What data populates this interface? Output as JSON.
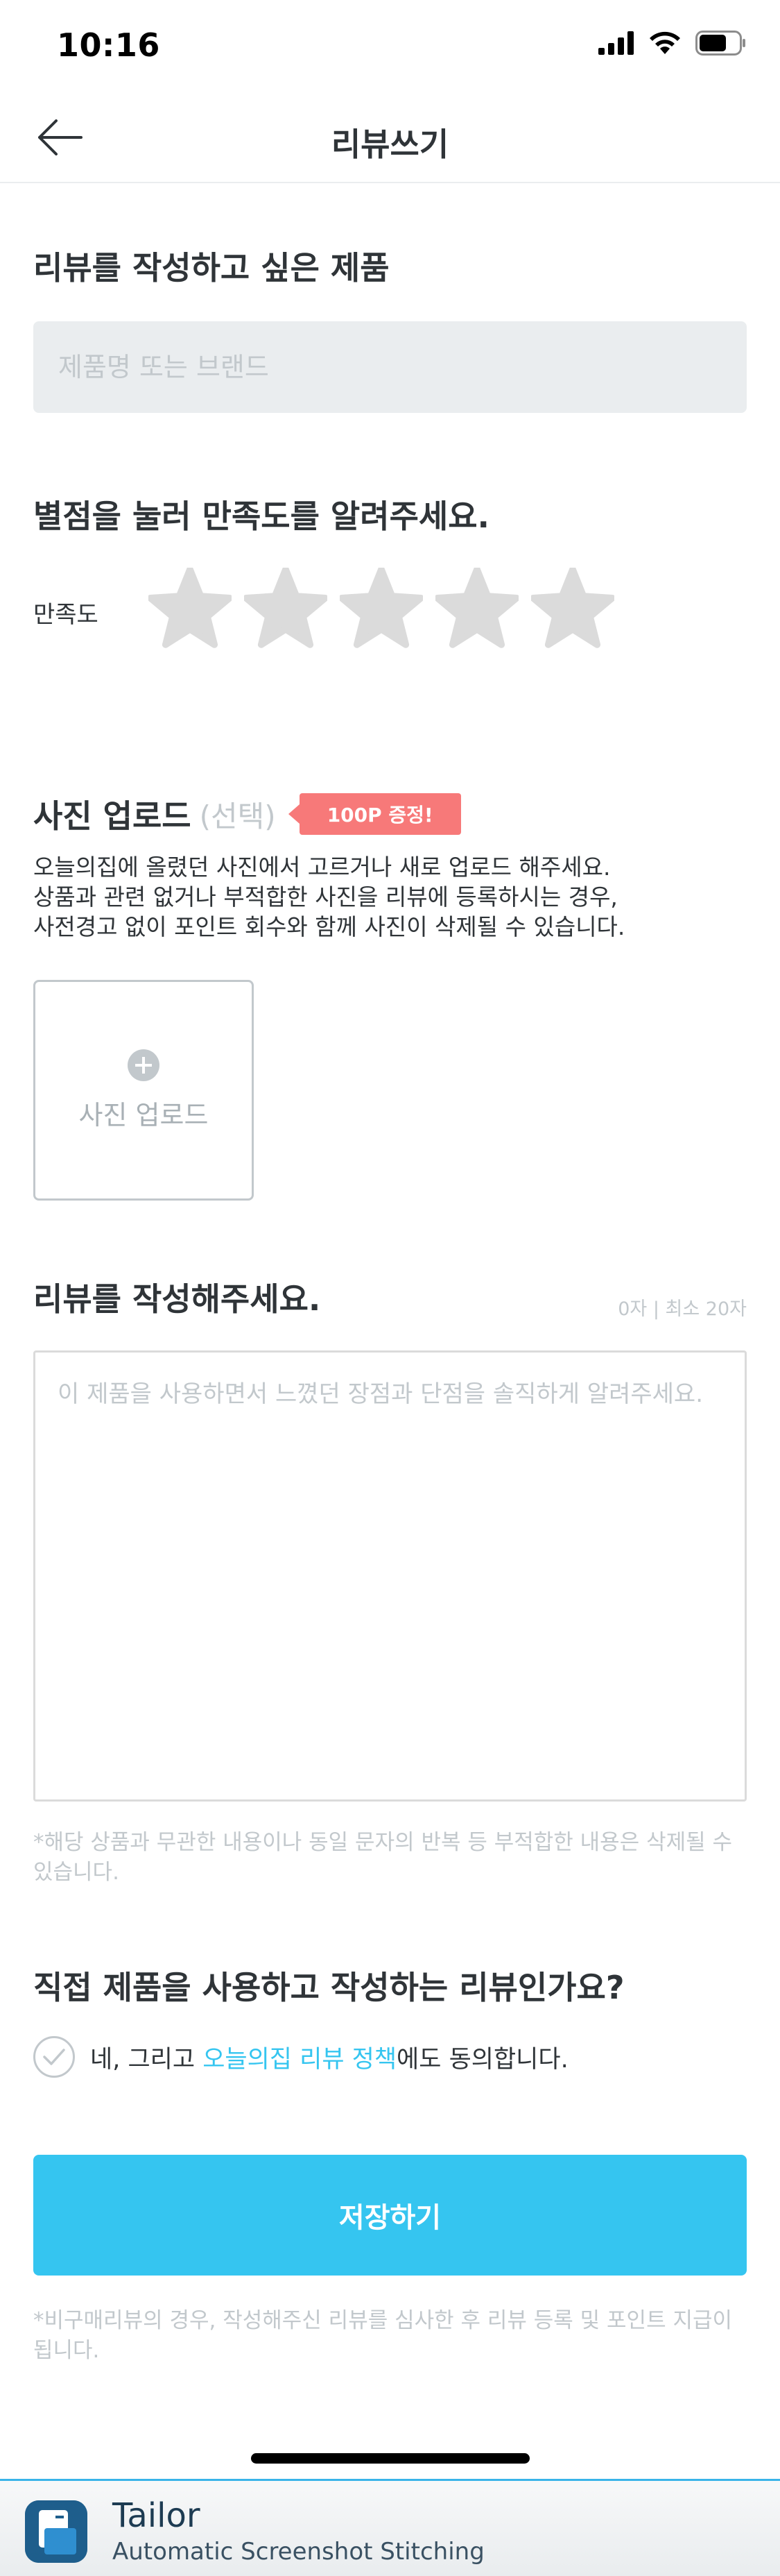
{
  "status_bar": {
    "time": "10:16"
  },
  "nav": {
    "title": "리뷰쓰기"
  },
  "product": {
    "section_title": "리뷰를 작성하고 싶은 제품",
    "input_placeholder": "제품명 또는 브랜드",
    "input_value": ""
  },
  "rating": {
    "section_title": "별점을 눌러 만족도를 알려주세요.",
    "label": "만족도",
    "max_stars": 5,
    "selected_stars": 0
  },
  "photo": {
    "title": "사진 업로드",
    "optional": "(선택)",
    "badge": "100P 증정!",
    "desc_lines": [
      "오늘의집에 올렸던 사진에서 고르거나 새로 업로드 해주세요.",
      "상품과 관련 없거나 부적합한 사진을 리뷰에 등록하시는 경우,",
      "사전경고 없이 포인트 회수와 함께 사진이 삭제될 수 있습니다."
    ],
    "upload_label": "사진 업로드"
  },
  "review": {
    "section_title": "리뷰를 작성해주세요.",
    "char_count": "0자 | 최소 20자",
    "textarea_placeholder": "이 제품을 사용하면서 느꼈던 장점과 단점을 솔직하게 알려주세요.",
    "textarea_value": "",
    "warning": "*해당 상품과 무관한 내용이나 동일 문자의 반복 등 부적합한 내용은 삭제될 수 있습니다."
  },
  "agreement": {
    "question": "직접 제품을 사용하고 작성하는 리뷰인가요?",
    "checked": false,
    "text_before": "네, 그리고 ",
    "policy_link": "오늘의집 리뷰 정책",
    "text_after": "에도 동의합니다."
  },
  "save": {
    "label": "저장하기",
    "note": "*비구매리뷰의 경우, 작성해주신 리뷰를 심사한 후 리뷰 등록 및 포인트 지급이 됩니다."
  },
  "tailor_banner": {
    "name": "Tailor",
    "subtitle": "Automatic Screenshot Stitching"
  },
  "colors": {
    "accent": "#35c5f0",
    "badge": "#f77979",
    "text": "#2f3438",
    "placeholder": "#c2c8cc",
    "star_empty": "#dbdbdb",
    "input_bg": "#eaedef"
  },
  "icons": {
    "back": "arrow-left-icon",
    "star": "star-icon",
    "add_photo": "plus-circle-icon",
    "check": "check-icon",
    "signal": "signal-icon",
    "wifi": "wifi-icon",
    "battery": "battery-icon"
  }
}
